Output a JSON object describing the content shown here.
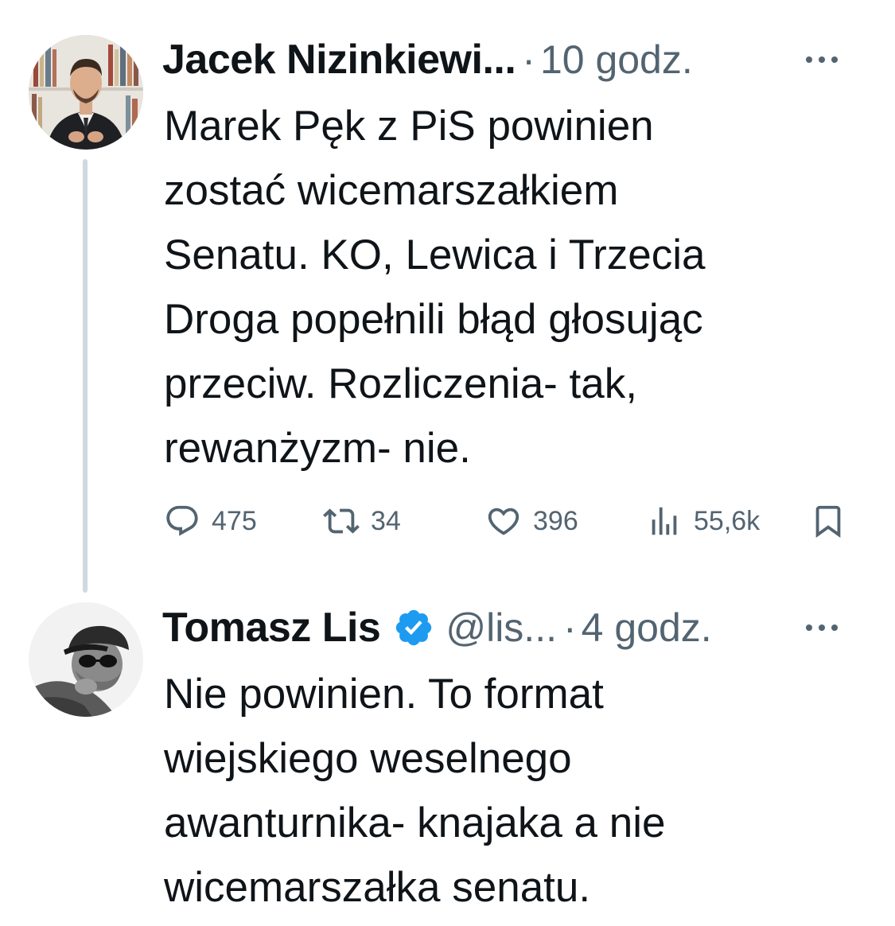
{
  "tweets": [
    {
      "author_name": "Jacek Nizinkiewi...",
      "separator": "·",
      "time": "10 godz.",
      "text_lines": [
        "Marek Pęk z PiS powinien",
        "zostać wicemarszałkiem",
        "Senatu. KO, Lewica i Trzecia",
        "Droga popełnili błąd głosując",
        "przeciw. Rozliczenia- tak,",
        "rewanżyzm- nie."
      ],
      "stats": {
        "replies": "475",
        "retweets": "34",
        "likes": "396",
        "views": "55,6k"
      }
    },
    {
      "author_name": "Tomasz Lis",
      "verified": true,
      "handle": "@lis...",
      "separator": "·",
      "time": "4 godz.",
      "text_lines": [
        "Nie powinien. To format",
        "wiejskiego weselnego",
        "awanturnika- knajaka a nie",
        "wicemarszałka senatu."
      ]
    }
  ],
  "icons": {
    "reply": "speech-bubble-icon",
    "retweet": "retweet-arrows-icon",
    "like": "heart-icon",
    "views": "bar-chart-icon",
    "bookmark": "bookmark-icon",
    "more": "ellipsis-icon",
    "verified": "verified-badge-icon"
  },
  "colors": {
    "text": "#0f1419",
    "secondary": "#536471",
    "verified": "#1d9bf0",
    "thread_line": "#cfd9de"
  }
}
